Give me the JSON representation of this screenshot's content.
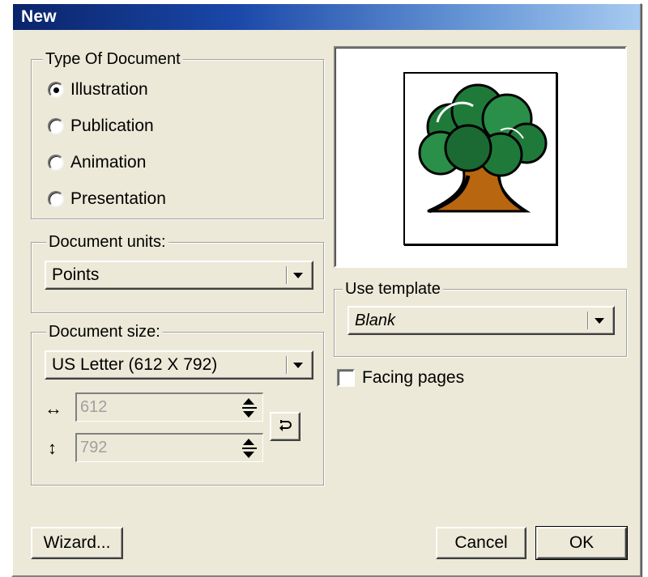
{
  "window": {
    "title": "New"
  },
  "type_of_document": {
    "legend": "Type Of Document",
    "options": [
      "Illustration",
      "Publication",
      "Animation",
      "Presentation"
    ],
    "selected": "Illustration"
  },
  "document_units": {
    "legend": "Document units:",
    "value": "Points"
  },
  "document_size": {
    "legend": "Document size:",
    "value": "US Letter (612 X 792)",
    "width": "612",
    "height": "792",
    "width_icon": "↔",
    "height_icon": "↕",
    "swap_icon": "rotate-icon"
  },
  "use_template": {
    "legend": "Use template",
    "value": "Blank"
  },
  "facing_pages": {
    "label": "Facing pages",
    "checked": false
  },
  "buttons": {
    "wizard": "Wizard...",
    "cancel": "Cancel",
    "ok": "OK"
  },
  "preview": {
    "icon": "tree-icon"
  },
  "colors": {
    "title_start": "#0a246a",
    "title_end": "#a6caf0",
    "face": "#ece9d8"
  }
}
